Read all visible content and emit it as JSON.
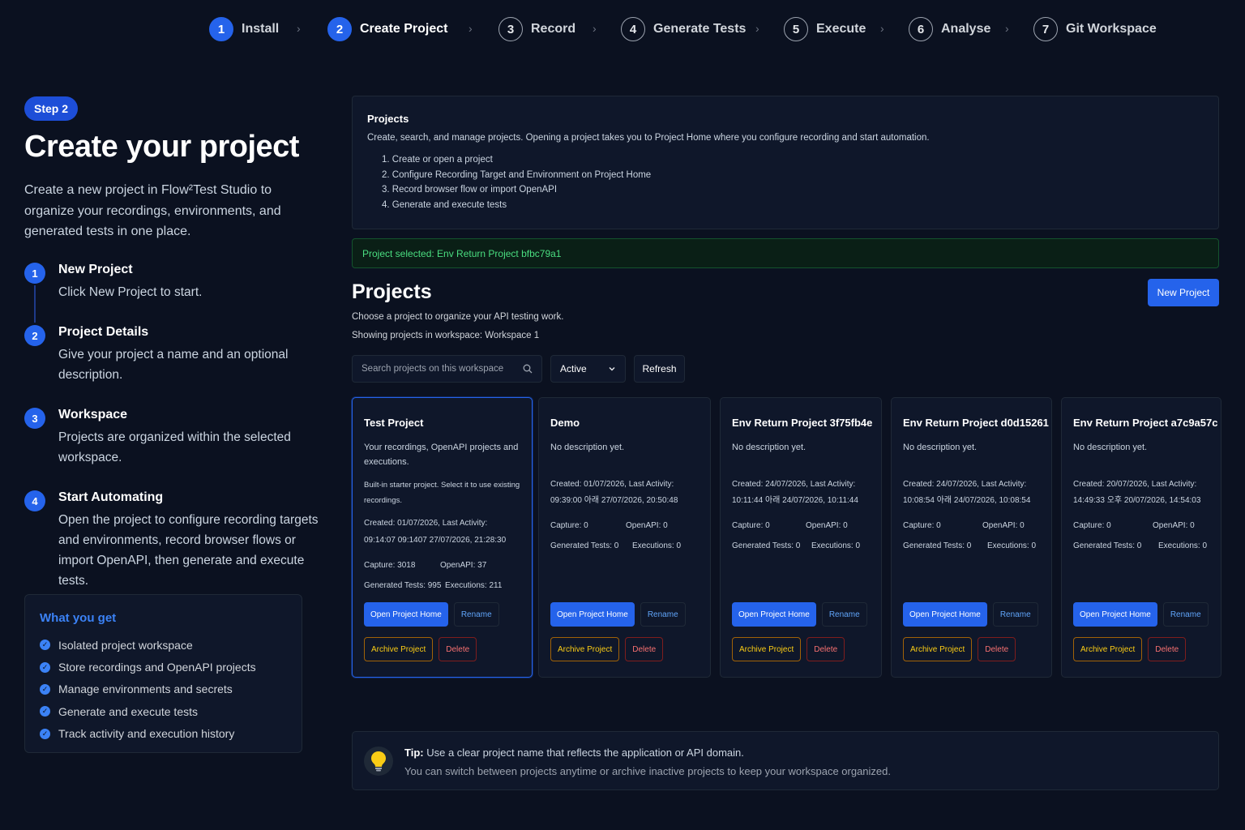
{
  "stepper": [
    {
      "num": "1",
      "label": "Install",
      "state": "done"
    },
    {
      "num": "2",
      "label": "Create Project",
      "state": "active"
    },
    {
      "num": "3",
      "label": "Record",
      "state": "todo"
    },
    {
      "num": "4",
      "label": "Generate Tests",
      "state": "todo"
    },
    {
      "num": "5",
      "label": "Execute",
      "state": "todo"
    },
    {
      "num": "6",
      "label": "Analyse",
      "state": "todo"
    },
    {
      "num": "7",
      "label": "Git Workspace",
      "state": "todo"
    }
  ],
  "left": {
    "badge": "Step 2",
    "title": "Create your project",
    "description": "Create a new project in Flow²Test Studio to organize your recordings, environments, and generated tests in one place.",
    "steps": [
      {
        "num": "1",
        "title": "New Project",
        "desc": "Click New Project to start."
      },
      {
        "num": "2",
        "title": "Project Details",
        "desc": "Give your project a name and an optional description."
      },
      {
        "num": "3",
        "title": "Workspace",
        "desc": "Projects are organized within the selected workspace."
      },
      {
        "num": "4",
        "title": "Start Automating",
        "desc": "Open the project to configure recording targets and environments, record browser flows or import OpenAPI, then generate and execute tests."
      }
    ],
    "what_you_get": {
      "title": "What you get",
      "items": [
        "Isolated project workspace",
        "Store recordings and OpenAPI projects",
        "Manage environments and secrets",
        "Generate and execute tests",
        "Track activity and execution history"
      ]
    }
  },
  "info": {
    "title": "Projects",
    "description": "Create, search, and manage projects. Opening a project takes you to Project Home where you configure recording and start automation.",
    "list": [
      "1. Create or open a project",
      "2. Configure Recording Target and Environment on Project Home",
      "3. Record browser flow or import OpenAPI",
      "4. Generate and execute tests"
    ]
  },
  "banner": "Project selected: Env Return Project bfbc79a1",
  "projects_header": {
    "title": "Projects",
    "subtitle": "Choose a project to organize your API testing work.",
    "workspace_line": "Showing projects in workspace: Workspace 1",
    "new_button": "New Project",
    "search_placeholder": "Search projects on this workspace",
    "filter_value": "Active",
    "refresh_label": "Refresh"
  },
  "cards": [
    {
      "name": "Test Project",
      "desc": "Your recordings, OpenAPI projects and executions.",
      "extra": "Built-in starter project. Select it to use existing recordings.",
      "meta1": "Created: 01/07/2026, Last Activity:",
      "meta2": "09:14:07   09:1407   27/07/2026, 21:28:30",
      "capture": "Capture: 3018",
      "openapi": "OpenAPI: 37",
      "generated": "Generated Tests: 995",
      "executions": "Executions: 211",
      "selected": true
    },
    {
      "name": "Demo",
      "desc": "No description yet.",
      "extra": "",
      "meta1": "Created: 01/07/2026, Last Activity:",
      "meta2": "09:39:00   아래   27/07/2026, 20:50:48",
      "capture": "Capture: 0",
      "openapi": "OpenAPI: 0",
      "generated": "Generated Tests: 0",
      "executions": "Executions: 0",
      "selected": false
    },
    {
      "name": "Env Return Project 3f75fb4e",
      "desc": "No description yet.",
      "extra": "",
      "meta1": "Created: 24/07/2026, Last Activity:",
      "meta2": "10:11:44   아래   24/07/2026, 10:11:44",
      "capture": "Capture: 0",
      "openapi": "OpenAPI: 0",
      "generated": "Generated Tests: 0",
      "executions": "Executions: 0",
      "selected": false
    },
    {
      "name": "Env Return Project d0d15261",
      "desc": "No description yet.",
      "extra": "",
      "meta1": "Created: 24/07/2026, Last Activity:",
      "meta2": "10:08:54   아래   24/07/2026, 10:08:54",
      "capture": "Capture: 0",
      "openapi": "OpenAPI: 0",
      "generated": "Generated Tests: 0",
      "executions": "Executions: 0",
      "selected": false
    },
    {
      "name": "Env Return Project a7c9a57c",
      "desc": "No description yet.",
      "extra": "",
      "meta1": "Created: 20/07/2026, Last Activity:",
      "meta2": "14:49:33   오후   20/07/2026, 14:54:03",
      "capture": "Capture: 0",
      "openapi": "OpenAPI: 0",
      "generated": "Generated Tests: 0",
      "executions": "Executions: 0",
      "selected": false
    }
  ],
  "card_buttons": {
    "open": "Open Project Home",
    "rename": "Rename",
    "archive": "Archive Project",
    "delete": "Delete"
  },
  "tip": {
    "label": "Tip:",
    "line1": "Use a clear project name that reflects the application or API domain.",
    "line2": "You can switch between projects anytime or archive inactive projects to keep your workspace organized."
  },
  "colors": {
    "background": "#0b1120",
    "accent": "#2563eb",
    "success": "#4ade80",
    "warning": "#facc15",
    "danger": "#f87171"
  }
}
